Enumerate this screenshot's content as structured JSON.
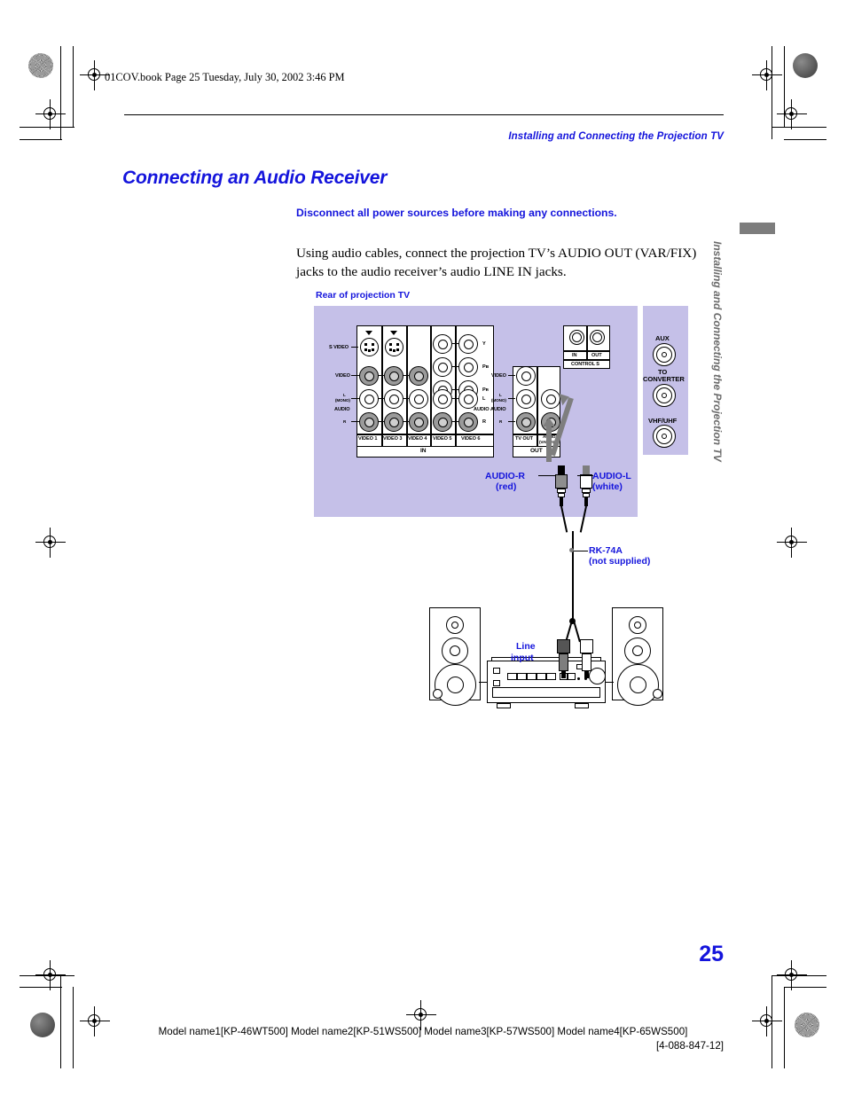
{
  "header": {
    "file_line": "01COV.book  Page 25  Tuesday, July 30, 2002  3:46 PM",
    "running_head": "Installing and Connecting the Projection TV"
  },
  "title": "Connecting an Audio Receiver",
  "warning": "Disconnect all power sources before making any connections.",
  "body": "Using audio cables, connect the projection TV’s AUDIO OUT (VAR/FIX) jacks to the audio receiver’s audio LINE IN jacks.",
  "side_tab": "Installing and Connecting the Projection TV",
  "page_number": "25",
  "footer": {
    "models": "Model name1[KP-46WT500] Model name2[KP-51WS500] Model name3[KP-57WS500] Model name4[KP-65WS500]",
    "code": "[4-088-847-12]"
  },
  "diagram": {
    "caption": "Rear of projection TV",
    "jack_labels": {
      "s_video": "S VIDEO",
      "video": "VIDEO",
      "audio": "AUDIO",
      "left": "L",
      "mono": "(MONO)",
      "right": "R",
      "y": "Y",
      "pb": "Pʙ",
      "pr": "Pʀ",
      "in": "IN",
      "out": "OUT",
      "control_s": "CONTROL S",
      "tv_out": "TV OUT",
      "audio_varfix_1": "AUDIO",
      "audio_varfix_2": "(VAR/FIX)",
      "aux": "AUX",
      "to_converter_1": "TO",
      "to_converter_2": "CONVERTER",
      "vhf_uhf": "VHF/UHF"
    },
    "video_groups": [
      "VIDEO 1",
      "VIDEO 3",
      "VIDEO 4",
      "VIDEO 5",
      "VIDEO 6"
    ],
    "callouts": {
      "audio_r": "AUDIO-R",
      "audio_r_color": "(red)",
      "audio_l": "AUDIO-L",
      "audio_l_color": "(white)",
      "cable": "RK-74A",
      "cable_note": "(not supplied)",
      "line_input_1": "Line",
      "line_input_2": "input"
    }
  },
  "colors": {
    "accent_blue": "#1414dc",
    "panel_lavender": "#c5c0e8",
    "tab_gray": "#7d7d7d",
    "arrow_gray": "#7e7e7e"
  }
}
